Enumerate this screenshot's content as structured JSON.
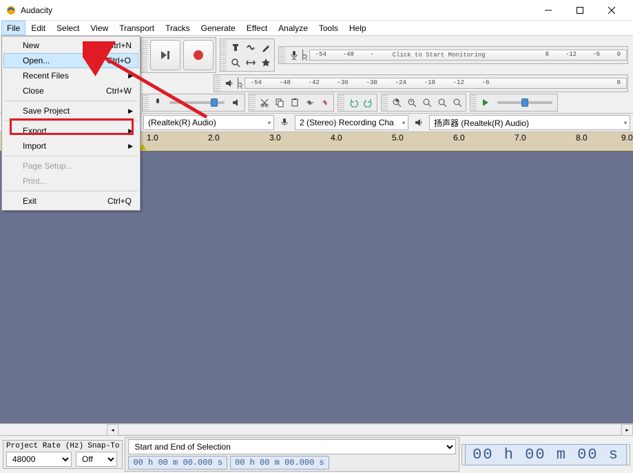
{
  "window": {
    "title": "Audacity"
  },
  "menubar": [
    "File",
    "Edit",
    "Select",
    "View",
    "Transport",
    "Tracks",
    "Generate",
    "Effect",
    "Analyze",
    "Tools",
    "Help"
  ],
  "file_menu": {
    "items": [
      {
        "label": "New",
        "shortcut": "Ctrl+N"
      },
      {
        "label": "Open...",
        "shortcut": "Ctrl+O",
        "highlight": true
      },
      {
        "label": "Recent Files",
        "submenu": true
      },
      {
        "label": "Close",
        "shortcut": "Ctrl+W"
      },
      {
        "sep": true
      },
      {
        "label": "Save Project",
        "submenu": true
      },
      {
        "sep": true
      },
      {
        "label": "Export",
        "submenu": true,
        "boxed": true
      },
      {
        "label": "Import",
        "submenu": true
      },
      {
        "sep": true
      },
      {
        "label": "Page Setup...",
        "disabled": true
      },
      {
        "label": "Print...",
        "disabled": true
      },
      {
        "sep": true
      },
      {
        "label": "Exit",
        "shortcut": "Ctrl+Q"
      }
    ]
  },
  "transport": {
    "icons": [
      "pause",
      "play",
      "stop",
      "skip-start",
      "skip-end",
      "record"
    ]
  },
  "meters": {
    "rec_ticks": [
      "-54",
      "-48",
      "-",
      "",
      "",
      "",
      "",
      "8",
      "-12",
      "-6",
      "0"
    ],
    "click_text": "Click to Start Monitoring",
    "play_ticks": [
      "-54",
      "-48",
      "-42",
      "-36",
      "-30",
      "-24",
      "-18",
      "-12",
      "-6",
      "0"
    ],
    "channel_l": "L",
    "channel_r": "R"
  },
  "devices": {
    "host": "(Realtek(R) Audio)",
    "rec_dev": "2 (Stereo) Recording Cha",
    "play_dev": "扬声器 (Realtek(R) Audio)"
  },
  "ruler": {
    "labels": [
      "1.0",
      "2.0",
      "3.0",
      "4.0",
      "5.0",
      "6.0",
      "7.0",
      "8.0",
      "9.0"
    ]
  },
  "status": {
    "project_rate_label": "Project Rate (Hz)",
    "project_rate_value": "48000",
    "snap_label": "Snap-To",
    "snap_value": "Off",
    "selection_label": "Start and End of Selection",
    "sel_start": "00 h 00 m 00.000 s",
    "sel_end": "00 h 00 m 00.000 s",
    "pos": "00 h 00 m 00 s"
  }
}
